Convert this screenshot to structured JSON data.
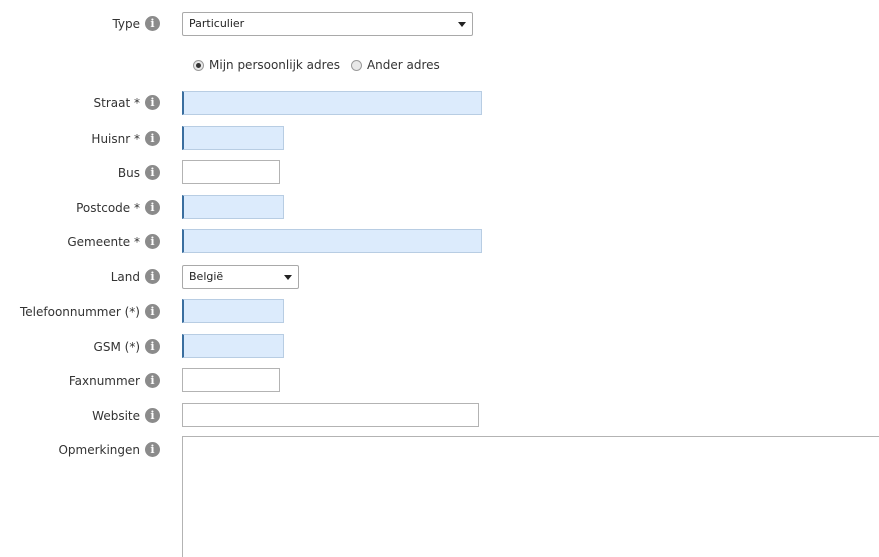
{
  "form": {
    "type": {
      "label": "Type",
      "value": "Particulier"
    },
    "address_choice": {
      "options": [
        "Mijn persoonlijk adres",
        "Ander adres"
      ],
      "selected": "Mijn persoonlijk adres"
    },
    "straat": {
      "label": "Straat *",
      "value": ""
    },
    "huisnr": {
      "label": "Huisnr *",
      "value": ""
    },
    "bus": {
      "label": "Bus",
      "value": ""
    },
    "postcode": {
      "label": "Postcode *",
      "value": ""
    },
    "gemeente": {
      "label": "Gemeente *",
      "value": ""
    },
    "land": {
      "label": "Land",
      "value": "België"
    },
    "telefoon": {
      "label": "Telefoonnummer (*)",
      "value": ""
    },
    "gsm": {
      "label": "GSM (*)",
      "value": ""
    },
    "fax": {
      "label": "Faxnummer",
      "value": ""
    },
    "website": {
      "label": "Website",
      "value": ""
    },
    "opmerkingen": {
      "label": "Opmerkingen",
      "value": ""
    }
  },
  "icons": {
    "info": "info-icon"
  },
  "info_glyph": "i",
  "colors": {
    "required_bg": "#dcebfc",
    "required_edge": "#3a6e9f",
    "info_icon": "#8b8b8b"
  }
}
